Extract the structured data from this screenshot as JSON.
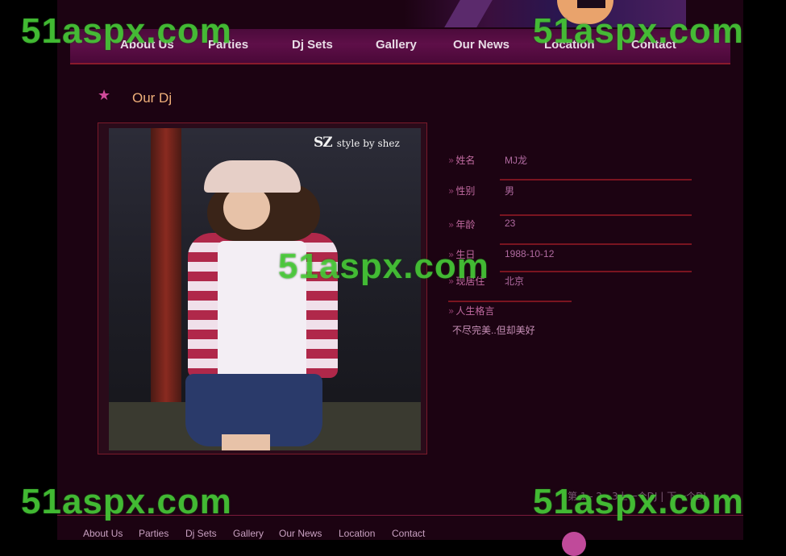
{
  "nav": {
    "items": [
      "About Us",
      "Parties",
      "Dj Sets",
      "Gallery",
      "Our News",
      "Location",
      "Contact"
    ]
  },
  "section": {
    "title": "Our Dj"
  },
  "photo": {
    "logo_mark": "SZ",
    "logo_text": "style by shez"
  },
  "profile": [
    {
      "label": "姓名",
      "value": "MJ龙"
    },
    {
      "label": "性别",
      "value": "男"
    },
    {
      "label": "年龄",
      "value": "23"
    },
    {
      "label": "生日",
      "value": "1988-10-12"
    },
    {
      "label": "现居住",
      "value": "北京"
    },
    {
      "label": "人生格言",
      "value": "不尽完美..但却美好"
    }
  ],
  "pager": {
    "text": "第 1 - 2 - 3上一个DJ | 下一个DJ"
  },
  "footer": {
    "items": [
      "About Us",
      "Parties",
      "Dj Sets",
      "Gallery",
      "Our News",
      "Location",
      "Contact"
    ]
  },
  "watermark": {
    "text": "51aspx.com"
  }
}
